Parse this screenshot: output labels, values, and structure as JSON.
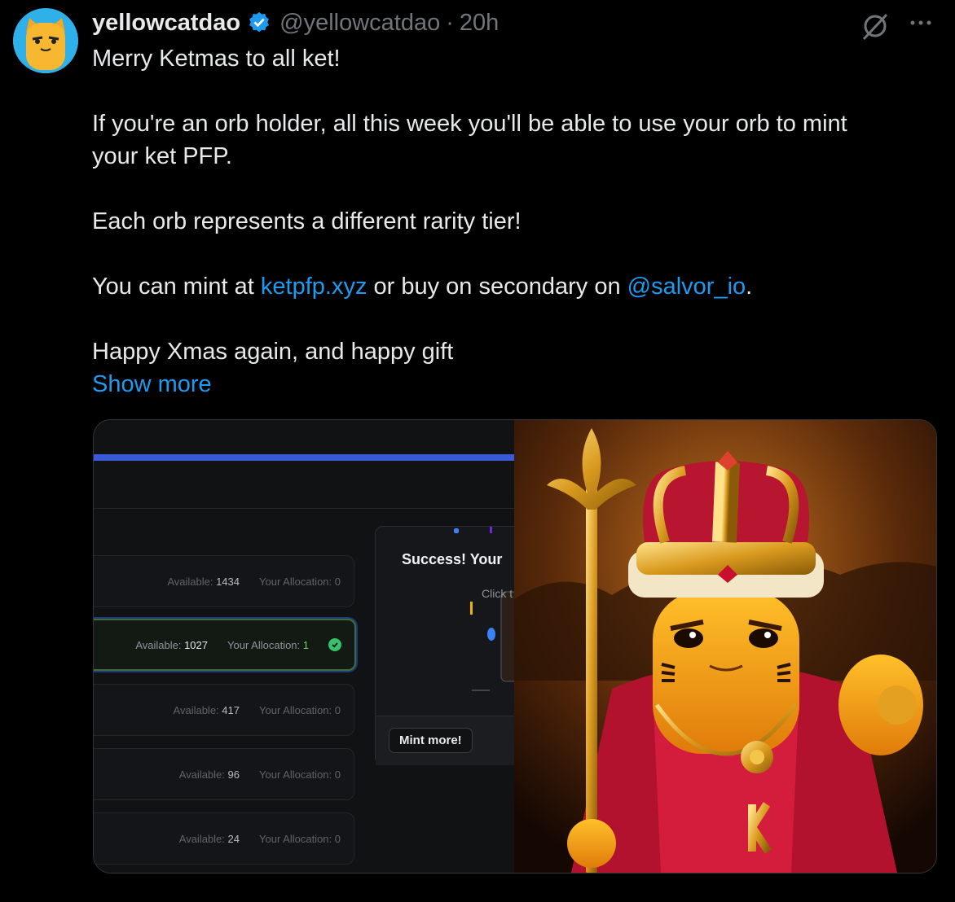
{
  "user": {
    "name": "yellowcatdao",
    "handle": "@yellowcatdao",
    "separator": "·",
    "time": "20h"
  },
  "tweet": {
    "line1": "Merry Ketmas to all ket!",
    "line2a": "If you're an orb holder, all this week you'll be able to use your orb to mint",
    "line2b": "your ket PFP.",
    "line3": "Each orb represents a different rarity tier!",
    "line4_pre": "You can mint at ",
    "line4_link": "ketpfp.xyz",
    "line4_mid": " or buy on secondary on ",
    "line4_mention": "@salvor_io",
    "line4_post": ".",
    "line5": "Happy Xmas again, and happy gift",
    "show_more": "Show more"
  },
  "media": {
    "rows": [
      {
        "available_label": "Available:",
        "available": "1434",
        "alloc_label": "Your Allocation:",
        "alloc": "0"
      },
      {
        "available_label": "Available:",
        "available": "1027",
        "alloc_label": "Your Allocation:",
        "alloc": "1"
      },
      {
        "available_label": "Available:",
        "available": "417",
        "alloc_label": "Your Allocation:",
        "alloc": "0"
      },
      {
        "available_label": "Available:",
        "available": "96",
        "alloc_label": "Your Allocation:",
        "alloc": "0"
      },
      {
        "available_label": "Available:",
        "available": "24",
        "alloc_label": "Your Allocation:",
        "alloc": "0"
      }
    ],
    "success_title": "Success! Your",
    "success_sub": "Click t",
    "mint_more": "Mint more!"
  },
  "colors": {
    "accent": "#1d9bf0",
    "background": "#000000",
    "text": "#e7e9ea",
    "muted": "#71767b"
  },
  "icons": {
    "verified": "verified-badge-icon",
    "grok": "grok-icon",
    "more": "more-icon",
    "check": "check-icon"
  }
}
